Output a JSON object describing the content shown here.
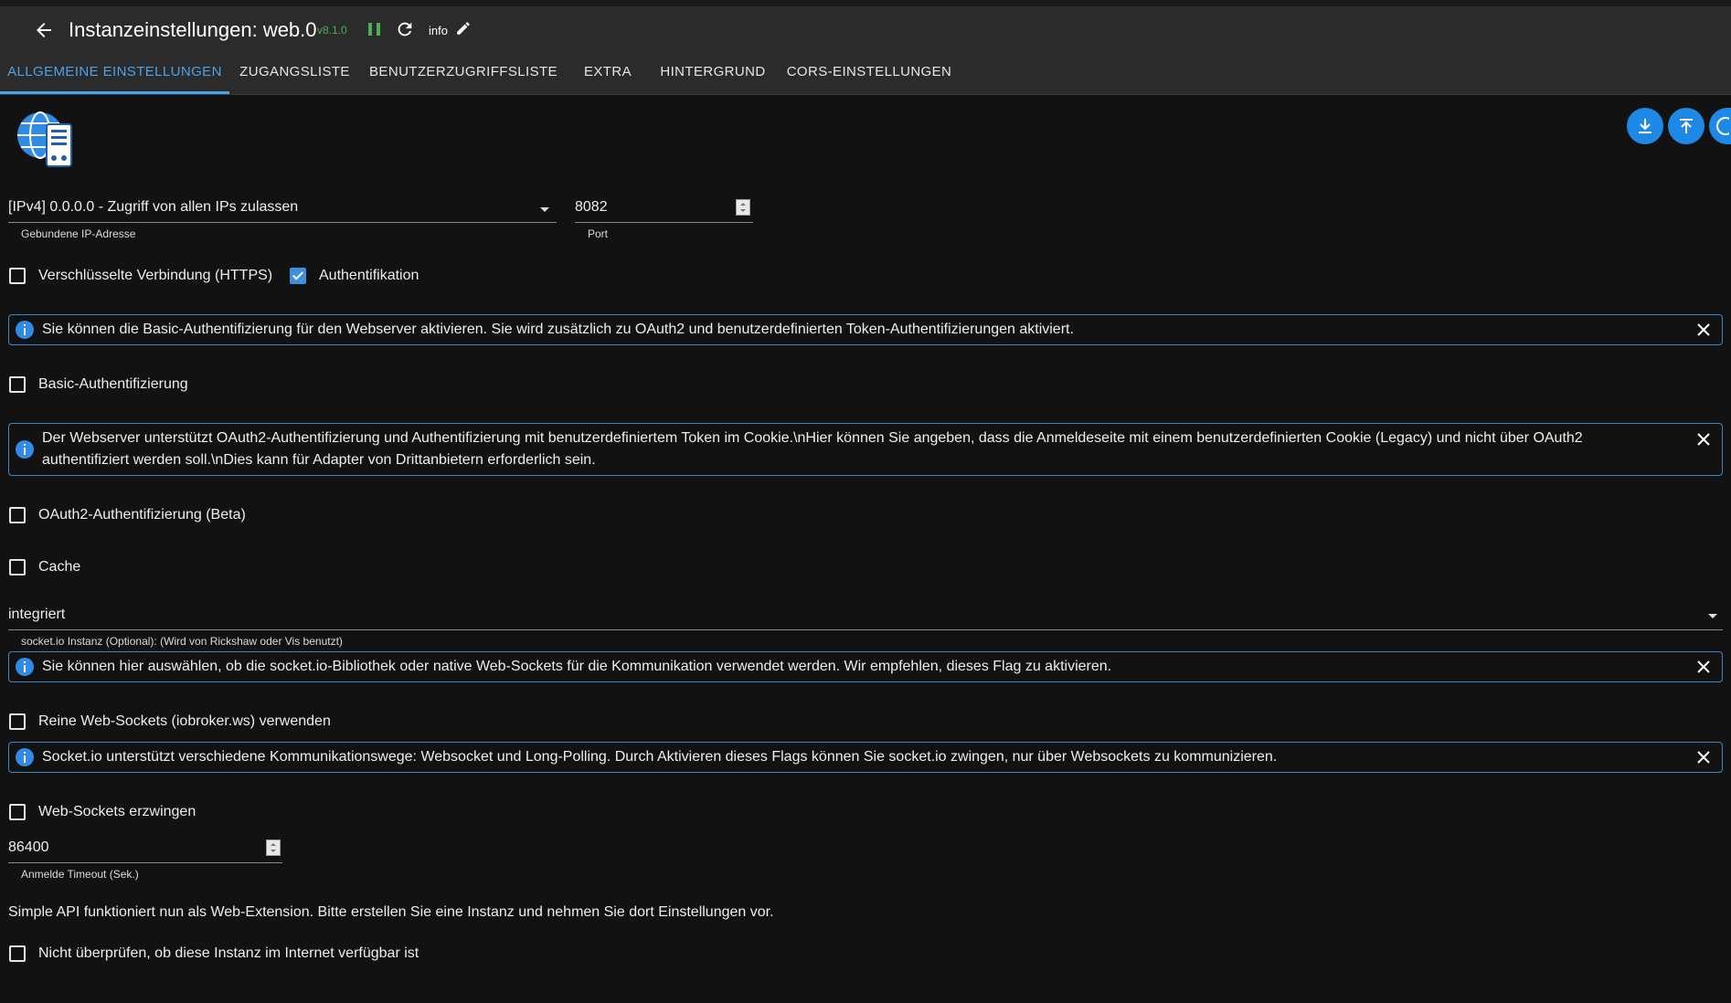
{
  "header": {
    "title": "Instanzeinstellungen: web.0",
    "version": "v8.1.0",
    "log_level": "info"
  },
  "tabs": [
    {
      "label": "ALLGEMEINE EINSTELLUNGEN",
      "active": true
    },
    {
      "label": "ZUGANGSLISTE"
    },
    {
      "label": "BENUTZERZUGRIFFSLISTE"
    },
    {
      "label": "EXTRA"
    },
    {
      "label": "HINTERGRUND"
    },
    {
      "label": "CORS-EINSTELLUNGEN"
    }
  ],
  "colors": {
    "accent": "#4aa3ea",
    "fab": "#1e88e5",
    "version": "#4caf50",
    "info_border": "#3d86c6"
  },
  "fabs": [
    "download-icon",
    "upload-icon",
    "help-icon"
  ],
  "form": {
    "bind": {
      "value": "[IPv4] 0.0.0.0 - Zugriff von allen IPs zulassen",
      "label": "Gebundene IP-Adresse"
    },
    "port": {
      "value": "8082",
      "label": "Port"
    },
    "https": {
      "label": "Verschlüsselte Verbindung (HTTPS)",
      "checked": false
    },
    "auth": {
      "label": "Authentifikation",
      "checked": true
    },
    "info_basic": "Sie können die Basic-Authentifizierung für den Webserver aktivieren. Sie wird zusätzlich zu OAuth2 und benutzerdefinierten Token-Authentifizierungen aktiviert.",
    "basic_auth": {
      "label": "Basic-Authentifizierung",
      "checked": false
    },
    "info_oauth": "Der Webserver unterstützt OAuth2-Authentifizierung und Authentifizierung mit benutzerdefiniertem Token im Cookie.\\nHier können Sie angeben, dass die Anmeldeseite mit einem benutzerdefinierten Cookie (Legacy) und nicht über OAuth2 authentifiziert werden soll.\\nDies kann für Adapter von Drittanbietern erforderlich sein.",
    "oauth2": {
      "label": "OAuth2-Authentifizierung (Beta)",
      "checked": false
    },
    "cache": {
      "label": "Cache",
      "checked": false
    },
    "socketio": {
      "value": "integriert",
      "label": "socket.io Instanz (Optional): (Wird von Rickshaw oder Vis benutzt)"
    },
    "info_socket": "Sie können hier auswählen, ob die socket.io-Bibliothek oder native Web-Sockets für die Kommunikation verwendet werden. Wir empfehlen, dieses Flag zu aktivieren.",
    "pure_ws": {
      "label": "Reine Web-Sockets (iobroker.ws) verwenden",
      "checked": false
    },
    "info_force": "Socket.io unterstützt verschiedene Kommunikationswege: Websocket und Long-Polling. Durch Aktivieren dieses Flags können Sie socket.io zwingen, nur über Websockets zu kommunizieren.",
    "force_ws": {
      "label": "Web-Sockets erzwingen",
      "checked": false
    },
    "timeout": {
      "value": "86400",
      "label": "Anmelde Timeout (Sek.)"
    },
    "simple_api_note": "Simple API funktioniert nun als Web-Extension. Bitte erstellen Sie eine Instanz und nehmen Sie dort Einstellungen vor.",
    "no_check": {
      "label": "Nicht überprüfen, ob diese Instanz im Internet verfügbar ist",
      "checked": false
    }
  }
}
